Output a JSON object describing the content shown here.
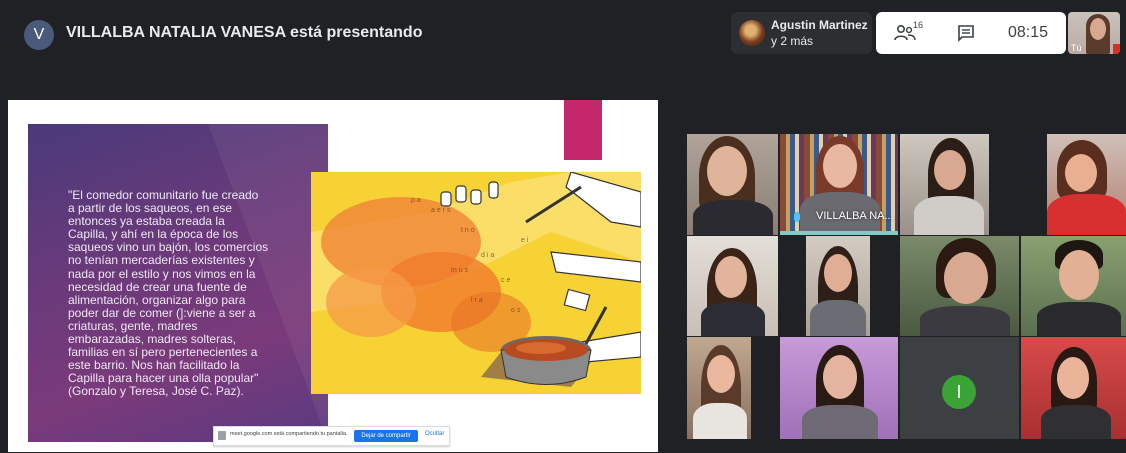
{
  "presenter": {
    "initial": "V",
    "title": "VILLALBA NATALIA VANESA está presentando"
  },
  "people": {
    "name": "Agustin Martinez",
    "more": "y 2 más"
  },
  "controls": {
    "participants_count": "16",
    "time": "08:15"
  },
  "self_view": {
    "label": "Tú"
  },
  "slide": {
    "quote": "\"El comedor comunitario fue creado\na partir de los saqueos, en ese\nentonces ya estaba creada la\nCapilla, y ahí en la época de los\nsaqueos vino un bajón, los comercios\nno tenían mercaderías existentes y\nnada por el estilo y nos vimos en la\nnecesidad de crear una fuente de\nalimentación, organizar algo para\npoder dar de comer (]:viene a ser a\ncriaturas, gente, madres\nembarazadas, madres solteras,\nfamilias en sí pero pertenecientes a\neste barrio. Nos han facilitado la\nCapilla para hacer una olla popular\"\n(Gonzalo y Teresa, José C. Paz)."
  },
  "share_bar": {
    "message": "meet.google.com está compartiendo tu pantalla.",
    "stop_label": "Dejar de compartir",
    "hide_label": "Ocultar"
  },
  "tiles": {
    "featured_name": "VILLALBA NA...",
    "initial": "I"
  },
  "colors": {
    "background": "#202124",
    "slide_purple": "#5a3a7a",
    "slide_yellow": "#f7d234",
    "accent_pink": "#c4286a",
    "share_blue": "#1a73e8",
    "initial_green": "#3aa335"
  }
}
